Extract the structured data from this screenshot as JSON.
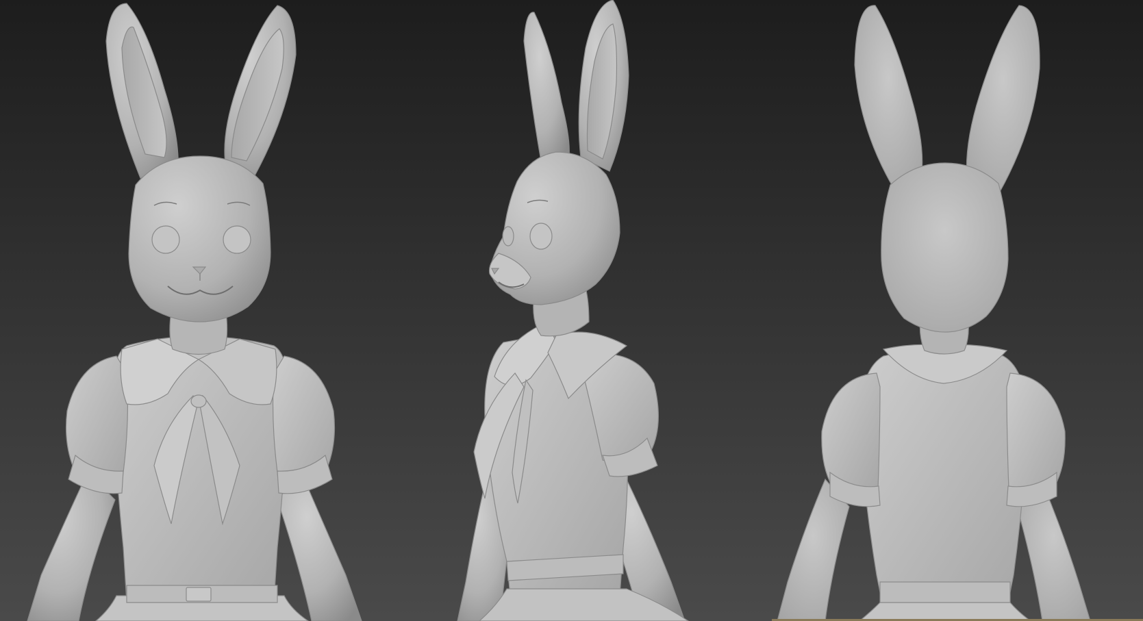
{
  "scene": {
    "views": [
      "front",
      "three-quarter",
      "back"
    ],
    "colors": {
      "background_top": "#1d1d1d",
      "background_bottom": "#4a4a4a",
      "model_light": "#cfcfcf",
      "model_mid": "#b2b2b2",
      "model_dark": "#8a8a8a",
      "crease": "#7a7a7a",
      "strip": "#8a7a58"
    }
  }
}
